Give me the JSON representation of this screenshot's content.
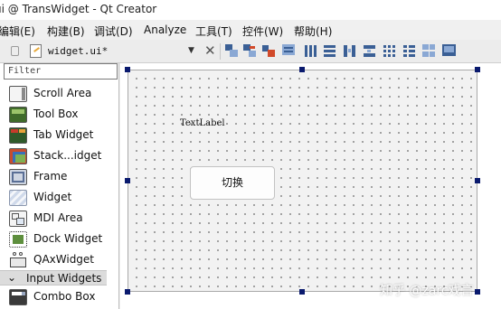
{
  "window": {
    "title": "ui @ TransWidget - Qt Creator"
  },
  "menu": {
    "items": [
      {
        "label": "编辑(E)"
      },
      {
        "label": "构建(B)"
      },
      {
        "label": "调试(D)"
      },
      {
        "label": "Analyze"
      },
      {
        "label": "工具(T)"
      },
      {
        "label": "控件(W)"
      },
      {
        "label": "帮助(H)"
      }
    ]
  },
  "toolbar": {
    "file_name": "widget.ui*",
    "combo_arrow": "▼",
    "close_glyph": "✕",
    "icons": [
      "lock-icon",
      "edit-file-icon",
      "edit-widgets-icon",
      "edit-signals-slots-icon",
      "edit-buddies-icon",
      "edit-tab-order-icon",
      "layout-horizontal-icon",
      "layout-vertical-icon",
      "layout-splitter-horizontal-icon",
      "layout-splitter-vertical-icon",
      "layout-grid-icon",
      "layout-form-icon",
      "break-layout-icon",
      "adjust-size-icon"
    ]
  },
  "sidebar": {
    "filter_placeholder": "Filter",
    "widgets": [
      {
        "label": "Scroll Area",
        "icon": "scroll-area-icon"
      },
      {
        "label": "Tool Box",
        "icon": "tool-box-icon"
      },
      {
        "label": "Tab Widget",
        "icon": "tab-widget-icon"
      },
      {
        "label": "Stack...idget",
        "icon": "stacked-widget-icon"
      },
      {
        "label": "Frame",
        "icon": "frame-icon"
      },
      {
        "label": "Widget",
        "icon": "widget-icon"
      },
      {
        "label": "MDI Area",
        "icon": "mdi-area-icon"
      },
      {
        "label": "Dock Widget",
        "icon": "dock-widget-icon"
      },
      {
        "label": "QAxWidget",
        "icon": "qaxwidget-icon"
      }
    ],
    "category": {
      "label": "Input Widgets",
      "chevron": "⌄"
    },
    "after_category": [
      {
        "label": "Combo Box",
        "icon": "combo-box-icon"
      }
    ]
  },
  "form": {
    "text_label": "TextLabel",
    "button_label": "切换"
  },
  "watermark": {
    "text": "知乎 @zarc戏言"
  }
}
